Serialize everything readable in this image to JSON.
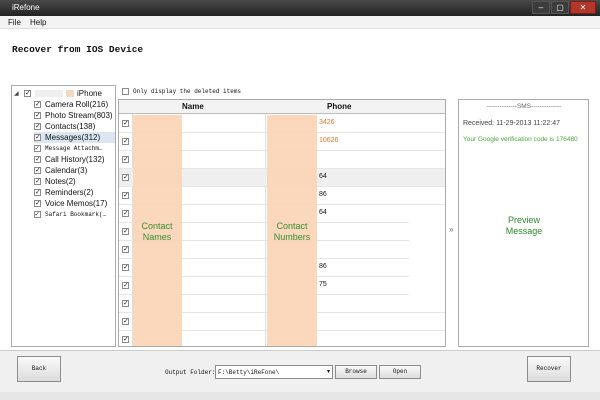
{
  "window": {
    "title": "iRefone",
    "controls": [
      "–",
      "▢",
      "✕"
    ]
  },
  "menu": {
    "items": [
      "File",
      "Help"
    ]
  },
  "header": {
    "title": "Recover from IOS Device"
  },
  "filter": {
    "only_deleted_label": "Only display the deleted items",
    "checked": false
  },
  "tree": {
    "device_label": "iPhone",
    "items": [
      {
        "label": "Camera Roll(216)",
        "checked": true
      },
      {
        "label": "Photo Stream(803)",
        "checked": true
      },
      {
        "label": "Contacts(138)",
        "checked": true
      },
      {
        "label": "Messages(312)",
        "checked": true,
        "selected": true
      },
      {
        "label": "Message Attachm…",
        "checked": true
      },
      {
        "label": "Call History(132)",
        "checked": true
      },
      {
        "label": "Calendar(3)",
        "checked": true
      },
      {
        "label": "Notes(2)",
        "checked": true
      },
      {
        "label": "Reminders(2)",
        "checked": true
      },
      {
        "label": "Voice Memos(17)",
        "checked": true
      },
      {
        "label": "Safari Bookmark(…",
        "checked": true
      }
    ]
  },
  "table": {
    "columns": [
      "Name",
      "Phone"
    ],
    "rows": [
      {
        "phone": "3426",
        "color": "#e0762a"
      },
      {
        "phone": "10626",
        "color": "#e0762a"
      },
      {
        "phone": ""
      },
      {
        "phone": "64",
        "highlight": true
      },
      {
        "phone": "86"
      },
      {
        "phone": "64"
      },
      {
        "phone": ""
      },
      {
        "phone": ""
      },
      {
        "phone": "86"
      },
      {
        "phone": "75"
      },
      {
        "phone": ""
      },
      {
        "phone": ""
      },
      {
        "phone": ""
      }
    ],
    "name_overlay": "Contact\nNames",
    "phone_overlay": "Contact\nNumbers"
  },
  "preview": {
    "title": "--------------SMS--------------",
    "received": "Received: 11-29-2013 11:22:47",
    "message": "Your Google verification code is 176480",
    "overlay": "Preview\nMessage"
  },
  "arrows": "»",
  "footer": {
    "back_label": "Back",
    "output_label": "Output Folder:",
    "output_value": "F:\\Betty\\iReFone\\",
    "dropdown_icon": "▾",
    "browse_label": "Browse",
    "open_label": "Open",
    "recover_label": "Recover"
  }
}
